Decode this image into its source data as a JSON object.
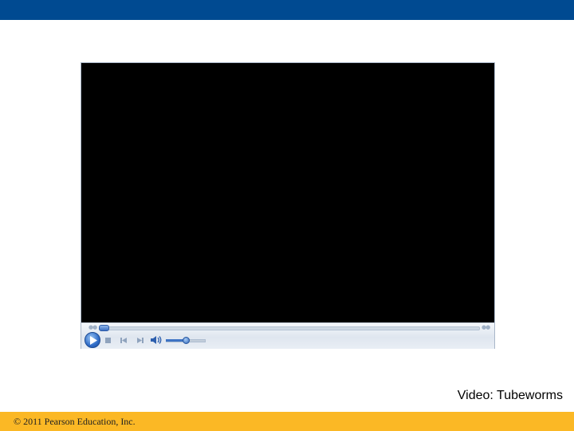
{
  "caption": "Video: Tubeworms",
  "footer": {
    "copyright": "© 2011 Pearson Education, Inc."
  },
  "colors": {
    "top_bar": "#004a91",
    "bottom_bar": "#fbb825",
    "video_background": "#000000"
  },
  "player": {
    "seek_progress": 0.0,
    "volume_level": 0.5,
    "icons": {
      "seek_back": "rewind-dots-icon",
      "seek_forward": "forward-dots-icon",
      "play": "play-icon",
      "stop": "stop-icon",
      "previous": "previous-track-icon",
      "next": "next-track-icon",
      "mute": "speaker-icon"
    }
  }
}
